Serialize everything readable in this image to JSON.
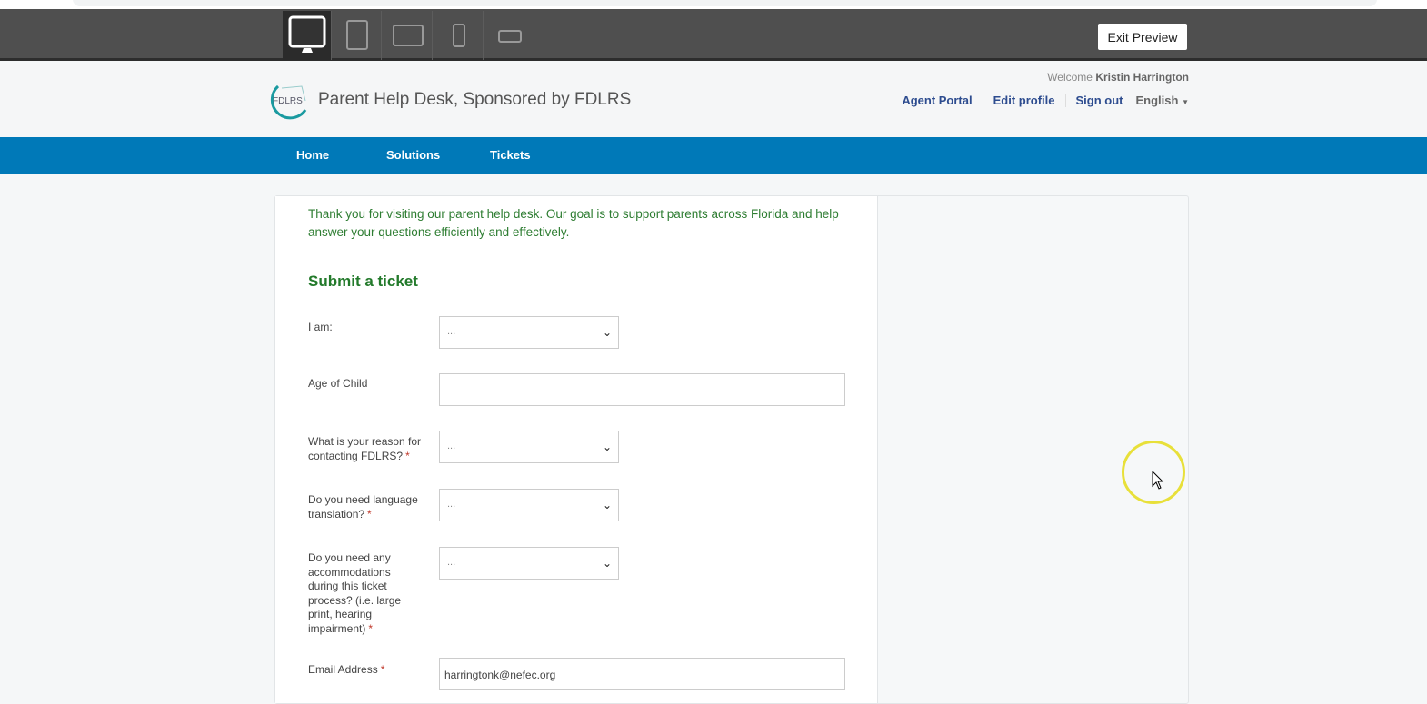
{
  "toolbar": {
    "devices": [
      "desktop-icon",
      "tablet-portrait-icon",
      "tablet-landscape-icon",
      "phone-portrait-icon",
      "phone-landscape-icon"
    ],
    "exit_label": "Exit Preview"
  },
  "header": {
    "logo_text": "FDLRS",
    "site_name": "Parent Help Desk, Sponsored by FDLRS",
    "welcome": "Welcome",
    "user_name": "Kristin Harrington",
    "links": [
      "Agent Portal",
      "Edit profile",
      "Sign out"
    ],
    "language": "English"
  },
  "nav": [
    "Home",
    "Solutions",
    "Tickets"
  ],
  "main": {
    "intro": "Thank you for visiting our parent help desk. Our goal is to support parents across Florida and help answer your questions efficiently and effectively.",
    "title": "Submit a ticket",
    "fields": [
      {
        "label": "I am:",
        "value": "..."
      },
      {
        "label": "Age of Child",
        "value": ""
      },
      {
        "label": "What is your reason for contacting FDLRS?",
        "value": "..."
      },
      {
        "label": "Do you need language translation?",
        "value": "..."
      },
      {
        "label": "Do you need any accommodations during this ticket process? (i.e. large print, hearing impairment)",
        "value": "..."
      },
      {
        "label": "Email Address",
        "value": "harringtonk@nefec.org"
      }
    ],
    "required_mark": "*"
  },
  "colors": {
    "nav": "#0079b8",
    "accent_green": "#237a2b",
    "link": "#2d4c8f"
  }
}
